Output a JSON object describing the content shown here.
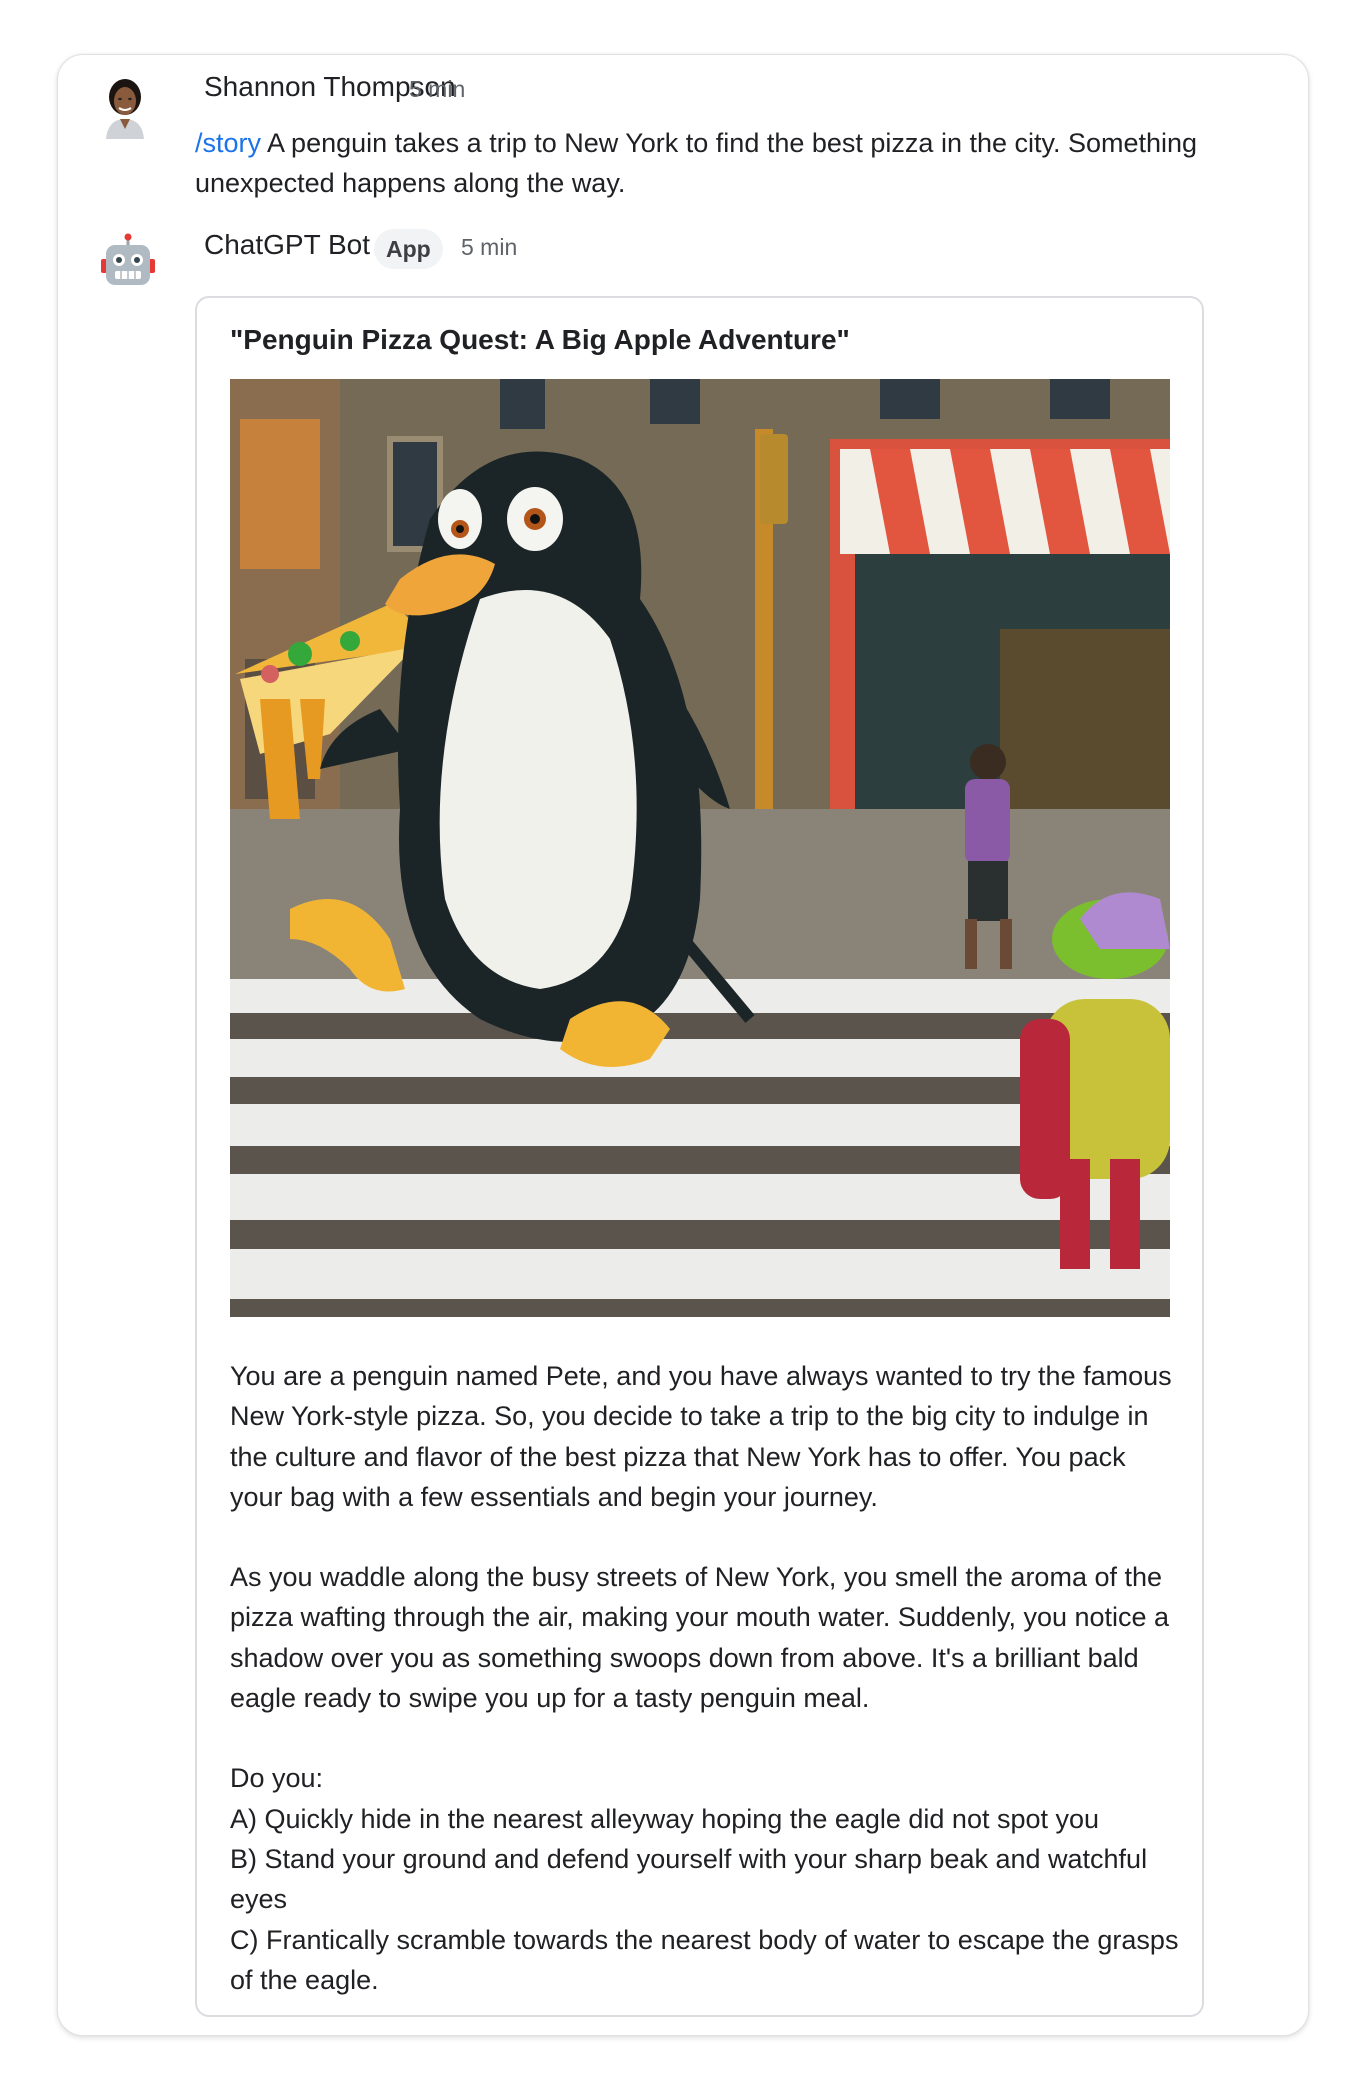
{
  "user_message": {
    "author": "Shannon Thompson",
    "time": "5 min",
    "command": "/story",
    "text": " A penguin takes a trip to New York to find the best pizza in the city. Something unexpected happens along the way."
  },
  "bot_message": {
    "author": "ChatGPT Bot",
    "badge": "App",
    "time": "5 min",
    "card": {
      "title": "\"Penguin Pizza Quest: A Big Apple Adventure\"",
      "paragraph1": "You are a penguin named Pete, and you have always wanted to try the famous New York-style pizza. So, you decide to take a trip to the big city to indulge in the culture and flavor of the best pizza that New York has to offer. You pack your bag with a few essentials and begin your journey.",
      "paragraph2": "As you waddle along the busy streets of New York, you smell the aroma of the pizza wafting through the air, making your mouth water. Suddenly, you notice a shadow over you as something swoops down from above. It's a brilliant bald eagle ready to swipe you up for a tasty penguin meal.",
      "prompt": "Do you:",
      "options": [
        "A) Quickly hide in the nearest alleyway hoping the eagle did not spot you",
        "B) Stand your ground and defend yourself with your sharp beak and watchful eyes",
        "C) Frantically scramble towards the nearest body of water to escape the grasps of the eagle."
      ]
    }
  },
  "icons": {
    "user_avatar": "person-avatar-icon",
    "bot_avatar": "robot-icon"
  }
}
